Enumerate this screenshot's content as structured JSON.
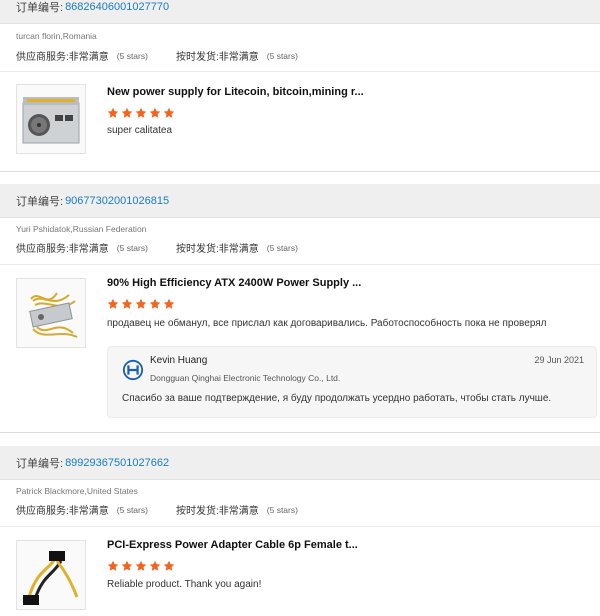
{
  "labels": {
    "order_no": "订单编号:",
    "supplier_service": "供应商服务:",
    "on_time_delivery": "按时发货:"
  },
  "colors": {
    "link": "#1a7cc7",
    "star": "#f4641e"
  },
  "orders": [
    {
      "order_id": "86826406001027770",
      "buyer": "turcan florin,Romania",
      "supplier_service": "非常满意",
      "supplier_stars": "(5 stars)",
      "delivery": "非常满意",
      "delivery_stars": "(5 stars)",
      "product_title": "New power supply for Litecoin, bitcoin,mining r...",
      "rating": 5,
      "review": "super calitatea",
      "thumb_icon": "power-supply-unit-image"
    },
    {
      "order_id": "90677302001026815",
      "buyer": "Yuri Pshidatok,Russian Federation",
      "supplier_service": "非常满意",
      "supplier_stars": "(5 stars)",
      "delivery": "非常满意",
      "delivery_stars": "(5 stars)",
      "product_title": "90% High Efficiency ATX 2400W Power Supply ...",
      "rating": 5,
      "review": "продавец не обманул, все прислал как договаривались. Работоспособность пока не проверял",
      "thumb_icon": "psu-with-cables-image",
      "reply": {
        "name": "Kevin Huang",
        "company": "Dongguan Qinghai Electronic Technology Co., Ltd.",
        "date": "29 Jun 2021",
        "text": "Спасибо за ваше подтверждение, я буду продолжать усердно работать, чтобы стать лучше."
      }
    },
    {
      "order_id": "89929367501027662",
      "buyer": "Patrick Blackmore,United States",
      "supplier_service": "非常满意",
      "supplier_stars": "(5 stars)",
      "delivery": "非常满意",
      "delivery_stars": "(5 stars)",
      "product_title": "PCI-Express Power Adapter Cable 6p Female t...",
      "rating": 5,
      "review": "Reliable product. Thank you again!",
      "thumb_icon": "adapter-cable-image"
    }
  ]
}
